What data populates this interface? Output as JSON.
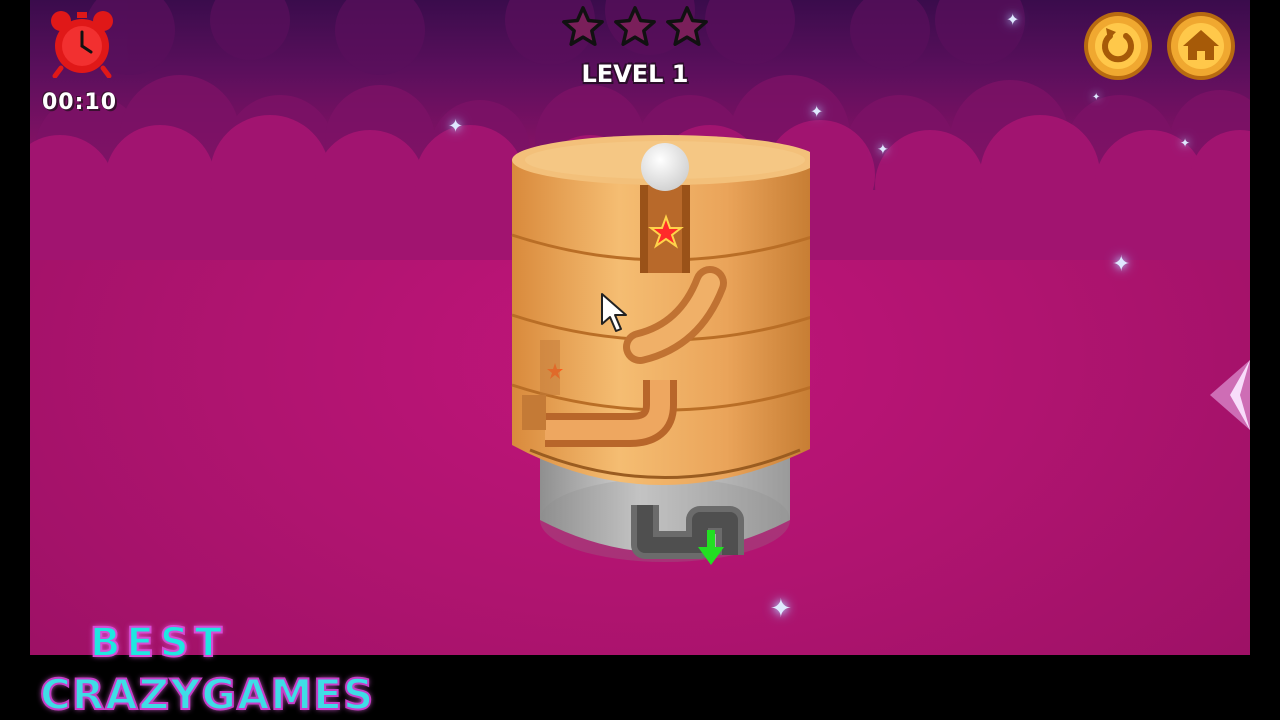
{
  "hud": {
    "timer": "00:10",
    "level_label": "LEVEL 1",
    "stars_total": 3,
    "stars_earned": 0
  },
  "buttons": {
    "restart_icon": "restart-icon",
    "home_icon": "home-icon"
  },
  "icons": {
    "timer_icon": "alarm-clock-icon",
    "star_icon": "star-outline-icon"
  },
  "watermark": {
    "line1": "BEST",
    "line2": "CRAZYGAMES"
  },
  "colors": {
    "background": "#b01470",
    "gold_button": "#f0a830",
    "timer_red": "#e01818",
    "wood": "#eaa45a",
    "goal_arrow": "#22e022"
  }
}
